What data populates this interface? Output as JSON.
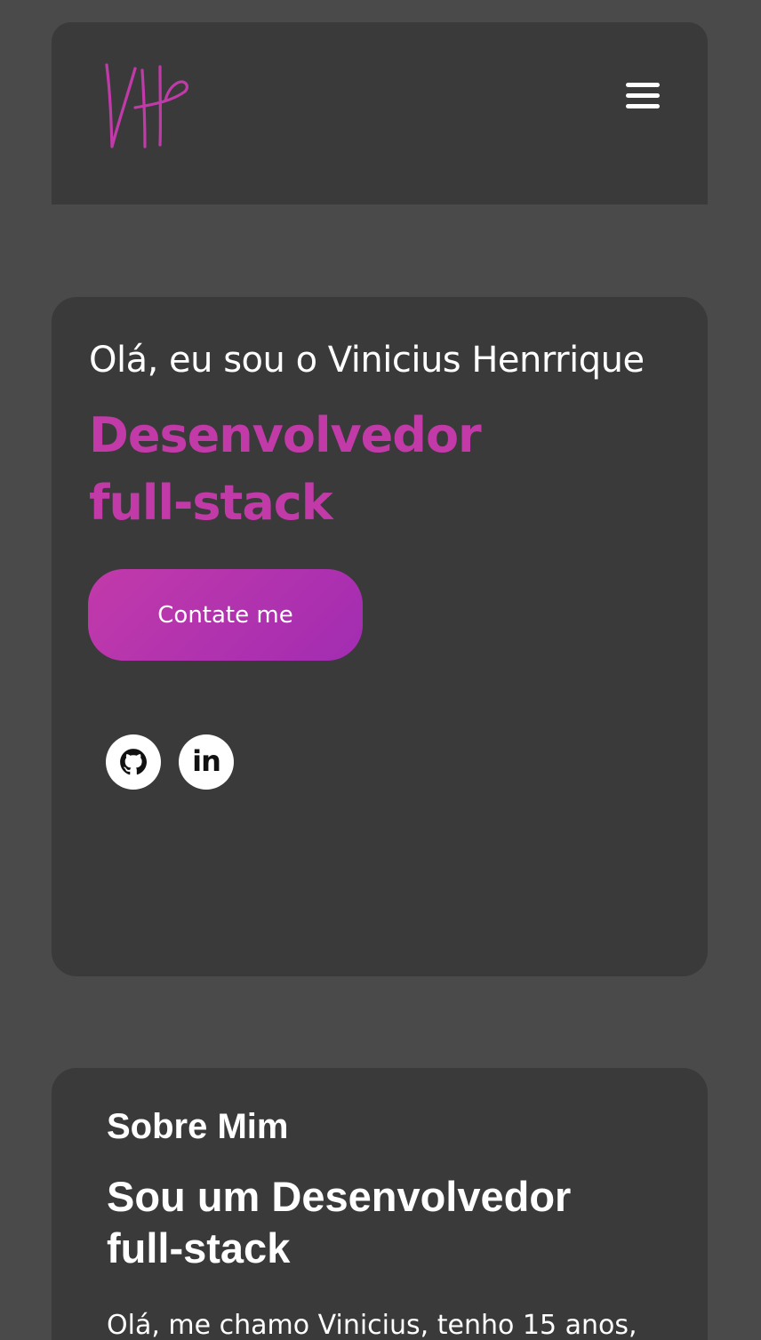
{
  "header": {
    "logo_text": "VH",
    "menu_icon": "hamburger-menu-icon"
  },
  "hero": {
    "greeting": "Olá, eu sou o Vinicius Henrrique",
    "role": "Desenvolvedor full-stack",
    "contact_label": "Contate me",
    "socials": [
      {
        "name": "github",
        "icon": "github-icon"
      },
      {
        "name": "linkedin",
        "icon": "linkedin-icon",
        "glyph": "in"
      }
    ]
  },
  "about": {
    "title": "Sobre Mim",
    "heading": "Sou um Desenvolvedor full-stack",
    "text": "Olá, me chamo Vinicius, tenho 15 anos,"
  },
  "colors": {
    "background": "#4a4a4a",
    "card": "#3a3a3a",
    "accent": "#c13aa8"
  }
}
